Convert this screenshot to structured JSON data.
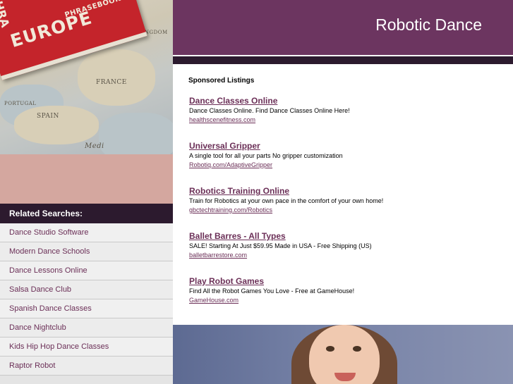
{
  "header": {
    "title": "Robotic Dance"
  },
  "hero_image": {
    "book_title": "EUROPE",
    "book_subtitle": "PHRASEBOOK",
    "book_spine": "PHRA",
    "map_labels": [
      "FRANCE",
      "SPAIN",
      "PORTUGAL",
      "UNITED KINGDOM",
      "Medi"
    ]
  },
  "related": {
    "heading": "Related Searches:",
    "items": [
      "Dance Studio Software",
      "Modern Dance Schools",
      "Dance Lessons Online",
      "Salsa Dance Club",
      "Spanish Dance Classes",
      "Dance Nightclub",
      "Kids Hip Hop Dance Classes",
      "Raptor Robot"
    ]
  },
  "sponsored": {
    "heading": "Sponsored Listings",
    "listings": [
      {
        "title": "Dance Classes Online",
        "desc": "Dance Classes Online. Find Dance Classes Online Here!",
        "url": "healthscenefitness.com"
      },
      {
        "title": "Universal Gripper",
        "desc": "A single tool for all your parts No gripper customization",
        "url": "Robotiq.com/AdaptiveGripper"
      },
      {
        "title": "Robotics Training Online",
        "desc": "Train for Robotics at your own pace in the comfort of your own home!",
        "url": "gbctechtraining.com/Robotics"
      },
      {
        "title": "Ballet Barres - All Types",
        "desc": "SALE! Starting At Just $59.95 Made in USA - Free Shipping (US)",
        "url": "balletbarrestore.com"
      },
      {
        "title": "Play Robot Games",
        "desc": "Find All the Robot Games You Love - Free at GameHouse!",
        "url": "GameHouse.com"
      }
    ]
  },
  "colors": {
    "header_bg": "#6c3560",
    "dark_band": "#2c1a2e",
    "link": "#6b2f57",
    "pink_block": "#d4a79f"
  }
}
